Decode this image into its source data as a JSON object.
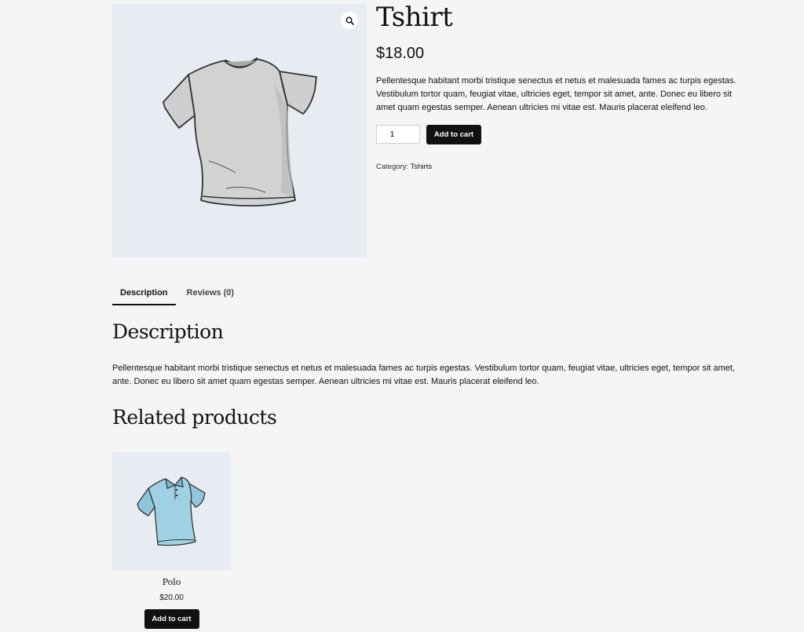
{
  "product": {
    "title": "Tshirt",
    "price": "$18.00",
    "short_description": "Pellentesque habitant morbi tristique senectus et netus et malesuada fames ac turpis egestas. Vestibulum tortor quam, feugiat vitae, ultricies eget, tempor sit amet, ante. Donec eu libero sit amet quam egestas semper. Aenean ultricies mi vitae est. Mauris placerat eleifend leo.",
    "quantity": "1",
    "add_to_cart_label": "Add to cart",
    "category_label": "Category: ",
    "category_value": "Tshirts",
    "image_icon": "tshirt-image",
    "zoom_icon": "search-icon"
  },
  "tabs": [
    {
      "label": "Description",
      "active": true
    },
    {
      "label": "Reviews (0)",
      "active": false
    }
  ],
  "description": {
    "heading": "Description",
    "text": "Pellentesque habitant morbi tristique senectus et netus et malesuada fames ac turpis egestas. Vestibulum tortor quam, feugiat vitae, ultricies eget, tempor sit amet, ante. Donec eu libero sit amet quam egestas semper. Aenean ultricies mi vitae est. Mauris placerat eleifend leo."
  },
  "related": {
    "heading": "Related products",
    "items": [
      {
        "name": "Polo",
        "price": "$20.00",
        "add_to_cart_label": "Add to cart",
        "image_icon": "polo-image"
      }
    ]
  },
  "colors": {
    "background": "#f5f5f5",
    "image_background": "#e7ebf2",
    "button": "#111111",
    "button_text": "#ffffff"
  }
}
